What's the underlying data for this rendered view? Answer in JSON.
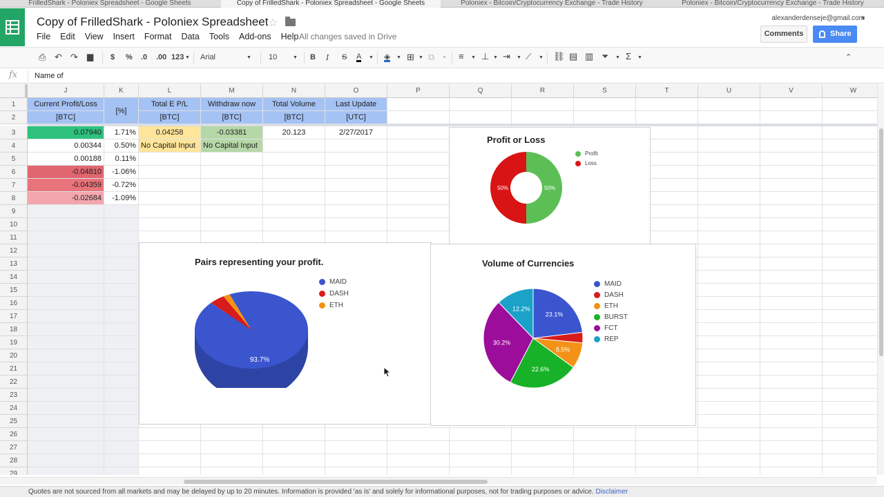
{
  "browser_tabs": [
    "FrilledShark - Poloniex Spreadsheet - Google Sheets",
    "Copy of FrilledShark - Poloniex Spreadsheet - Google Sheets",
    "Poloniex - Bitcoin/Cryptocurrency Exchange - Trade History",
    "Poloniex - Bitcoin/Cryptocurrency Exchange - Trade History"
  ],
  "header": {
    "title": "Copy of FrilledShark - Poloniex Spreadsheet",
    "save_status": "All changes saved in Drive",
    "user_email": "alexanderdenseje@gmail.com",
    "comments_label": "Comments",
    "share_label": "Share",
    "menu": [
      "File",
      "Edit",
      "View",
      "Insert",
      "Format",
      "Data",
      "Tools",
      "Add-ons",
      "Help"
    ]
  },
  "toolbar": {
    "currency": "$",
    "percent": "%",
    "decimal_less": ".0",
    "decimal_more": ".00",
    "more_formats": "123",
    "font": "Arial",
    "font_size": "10",
    "bold": "B",
    "italic": "I",
    "strike": "S",
    "text_color": "A",
    "functions": "Σ"
  },
  "formula_bar": {
    "fx": "fx",
    "content": "Name of"
  },
  "grid": {
    "columns": [
      "J",
      "K",
      "L",
      "M",
      "N",
      "O",
      "P",
      "Q",
      "R",
      "S",
      "T",
      "U",
      "V",
      "W"
    ],
    "rows": [
      "1",
      "2",
      "3",
      "4",
      "5",
      "6",
      "7",
      "8",
      "9",
      "10",
      "11",
      "12",
      "13",
      "14",
      "15",
      "16",
      "17",
      "18",
      "19",
      "20",
      "21",
      "22",
      "23",
      "24",
      "25",
      "26",
      "27",
      "28",
      "29"
    ],
    "headers": {
      "J": "Current Profit/Loss",
      "J2": "[BTC]",
      "K": "[%]",
      "L": "Total E P/L",
      "L2": "[BTC]",
      "M": "Withdraw now",
      "M2": "[BTC]",
      "N": "Total Volume",
      "N2": "[BTC]",
      "O": "Last Update",
      "O2": "[UTC]"
    },
    "values": {
      "J3": "0.07940",
      "K3": "1.71%",
      "L3": "0.04258",
      "M3": "-0.03381",
      "N3": "20.123",
      "O3": "2/27/2017",
      "J4": "0.00344",
      "K4": "0.50%",
      "L4": "No Capital Input",
      "M4": "No Capital Input",
      "J5": "0.00188",
      "K5": "0.11%",
      "J6": "-0.04810",
      "K6": "-1.06%",
      "J7": "-0.04359",
      "K7": "-0.72%",
      "J8": "-0.02684",
      "K8": "-1.09%"
    }
  },
  "charts": {
    "profit_loss": {
      "title": "Profit or Loss",
      "legend": [
        "Profit",
        "Loss"
      ],
      "labels": [
        "50%",
        "50%"
      ]
    },
    "pairs": {
      "title": "Pairs representing your profit.",
      "legend": [
        "MAID",
        "DASH",
        "ETH"
      ],
      "label": "93.7%"
    },
    "volume": {
      "title": "Volume of Currencies",
      "legend": [
        "MAID",
        "DASH",
        "ETH",
        "BURST",
        "FCT",
        "REP"
      ],
      "labels": [
        "23.1%",
        "8.5%",
        "22.6%",
        "30.2%",
        "12.2%"
      ]
    }
  },
  "chart_data": [
    {
      "type": "pie",
      "title": "Profit or Loss",
      "categories": [
        "Profit",
        "Loss"
      ],
      "values": [
        50,
        50
      ],
      "colors": [
        "#5cbf55",
        "#d91414"
      ]
    },
    {
      "type": "pie",
      "title": "Pairs representing your profit.",
      "categories": [
        "MAID",
        "DASH",
        "ETH"
      ],
      "values": [
        93.7,
        4.4,
        1.9
      ],
      "colors": [
        "#3b55cf",
        "#d81b1b",
        "#f39217"
      ]
    },
    {
      "type": "pie",
      "title": "Volume of Currencies",
      "categories": [
        "MAID",
        "DASH",
        "ETH",
        "BURST",
        "FCT",
        "REP"
      ],
      "values": [
        23.1,
        3.4,
        8.5,
        22.6,
        30.2,
        12.2
      ],
      "colors": [
        "#3b55cf",
        "#d81b1b",
        "#f39217",
        "#17b227",
        "#9c0d9b",
        "#1aa2c8"
      ]
    }
  ],
  "footer": {
    "notice": "Quotes are not sourced from all markets and may be delayed by up to 20 minutes. Information is provided 'as is' and solely for informational purposes, not for trading purposes or advice.",
    "disclaimer": "Disclaimer"
  }
}
